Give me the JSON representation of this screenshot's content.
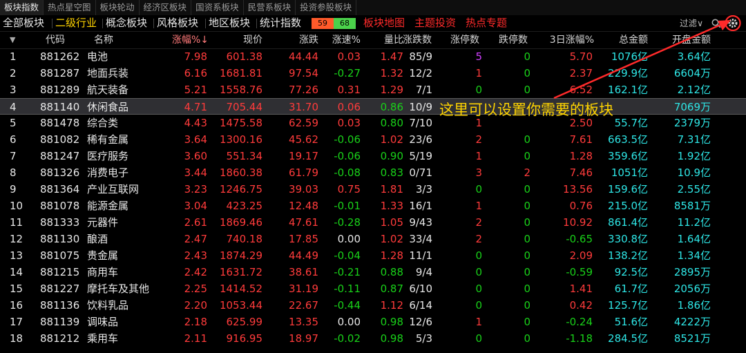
{
  "top_tabs": [
    "板块指数",
    "热点星空图",
    "板块轮动",
    "经济区板块",
    "国资系板块",
    "民营系板块",
    "投资参股板块"
  ],
  "active_tab_index": 0,
  "toolbar": {
    "items": [
      "全部板块",
      "二级行业",
      "概念板块",
      "风格板块",
      "地区板块",
      "统计指数"
    ],
    "selected_index": 1,
    "badge_up": "59",
    "badge_down": "68",
    "red_items": [
      "板块地图",
      "主题投资",
      "热点专题"
    ],
    "filter_label": "过滤∨"
  },
  "columns": [
    "代码",
    "名称",
    "涨幅%↓",
    "现价",
    "涨跌",
    "涨速%",
    "量比",
    "涨跌数",
    "涨停数",
    "跌停数",
    "3日涨幅%",
    "总金额",
    "开盘金额"
  ],
  "highlighted_row": 3,
  "rows": [
    [
      "1",
      "881262",
      "电池",
      "7.98",
      "601.38",
      "44.44",
      "0.03",
      "1.47",
      "85/9",
      "5",
      "0",
      "5.70",
      "1076亿",
      "3.64亿"
    ],
    [
      "2",
      "881287",
      "地面兵装",
      "6.16",
      "1681.81",
      "97.54",
      "-0.27",
      "1.32",
      "12/2",
      "1",
      "0",
      "2.37",
      "229.9亿",
      "6604万"
    ],
    [
      "3",
      "881289",
      "航天装备",
      "5.21",
      "1558.76",
      "77.26",
      "0.31",
      "1.29",
      "7/1",
      "0",
      "0",
      "6.52",
      "162.1亿",
      "2.12亿"
    ],
    [
      "4",
      "881140",
      "休闲食品",
      "4.71",
      "705.44",
      "31.70",
      "0.06",
      "0.86",
      "10/9",
      "",
      "",
      "",
      "",
      "7069万"
    ],
    [
      "5",
      "881478",
      "综合类",
      "4.43",
      "1475.58",
      "62.59",
      "0.03",
      "0.80",
      "7/10",
      "1",
      "",
      "2.50",
      "55.7亿",
      "2379万"
    ],
    [
      "6",
      "881082",
      "稀有金属",
      "3.64",
      "1300.16",
      "45.62",
      "-0.06",
      "1.02",
      "23/6",
      "2",
      "0",
      "7.61",
      "663.5亿",
      "7.31亿"
    ],
    [
      "7",
      "881247",
      "医疗服务",
      "3.60",
      "551.34",
      "19.17",
      "-0.06",
      "0.90",
      "5/19",
      "1",
      "0",
      "1.28",
      "359.6亿",
      "1.92亿"
    ],
    [
      "8",
      "881326",
      "消费电子",
      "3.44",
      "1860.38",
      "61.79",
      "-0.08",
      "0.83",
      "0/71",
      "3",
      "2",
      "7.46",
      "1051亿",
      "10.9亿"
    ],
    [
      "9",
      "881364",
      "产业互联网",
      "3.23",
      "1246.75",
      "39.03",
      "0.75",
      "1.81",
      "3/3",
      "0",
      "0",
      "13.56",
      "159.6亿",
      "2.55亿"
    ],
    [
      "10",
      "881078",
      "能源金属",
      "3.04",
      "423.25",
      "12.48",
      "-0.01",
      "1.33",
      "16/1",
      "1",
      "0",
      "0.76",
      "215.0亿",
      "8581万"
    ],
    [
      "11",
      "881333",
      "元器件",
      "2.61",
      "1869.46",
      "47.61",
      "-0.28",
      "1.05",
      "9/43",
      "2",
      "0",
      "10.92",
      "861.4亿",
      "11.2亿"
    ],
    [
      "12",
      "881130",
      "酿酒",
      "2.47",
      "740.18",
      "17.85",
      "0.00",
      "1.02",
      "33/4",
      "2",
      "0",
      "-0.65",
      "330.8亿",
      "1.64亿"
    ],
    [
      "13",
      "881075",
      "贵金属",
      "2.43",
      "1874.29",
      "44.49",
      "-0.04",
      "1.28",
      "11/1",
      "0",
      "0",
      "2.09",
      "138.2亿",
      "1.34亿"
    ],
    [
      "14",
      "881215",
      "商用车",
      "2.42",
      "1631.72",
      "38.61",
      "-0.21",
      "0.88",
      "9/4",
      "0",
      "0",
      "-0.59",
      "92.5亿",
      "2895万"
    ],
    [
      "15",
      "881227",
      "摩托车及其他",
      "2.25",
      "1414.52",
      "31.19",
      "-0.11",
      "0.87",
      "6/10",
      "0",
      "0",
      "1.41",
      "61.7亿",
      "2056万"
    ],
    [
      "16",
      "881136",
      "饮料乳品",
      "2.20",
      "1053.44",
      "22.67",
      "-0.44",
      "1.12",
      "6/14",
      "0",
      "0",
      "0.42",
      "125.7亿",
      "1.86亿"
    ],
    [
      "17",
      "881139",
      "调味品",
      "2.18",
      "625.99",
      "13.35",
      "0.00",
      "0.98",
      "12/6",
      "1",
      "0",
      "-0.24",
      "51.6亿",
      "4222万"
    ],
    [
      "18",
      "881212",
      "乘用车",
      "2.11",
      "916.95",
      "18.97",
      "-0.02",
      "0.98",
      "5/3",
      "0",
      "0",
      "-1.18",
      "284.5亿",
      "8521万"
    ]
  ],
  "annotation": "这里可以设置你需要的板块",
  "colors": {
    "up": "#ff3b3b",
    "down": "#19d219",
    "amount": "#2ee6e6",
    "selected": "#ffd400",
    "limit_up": "#d040ff"
  },
  "icons": [
    "search-icon",
    "settings-gear-icon",
    "arrow-pointer-icon"
  ]
}
